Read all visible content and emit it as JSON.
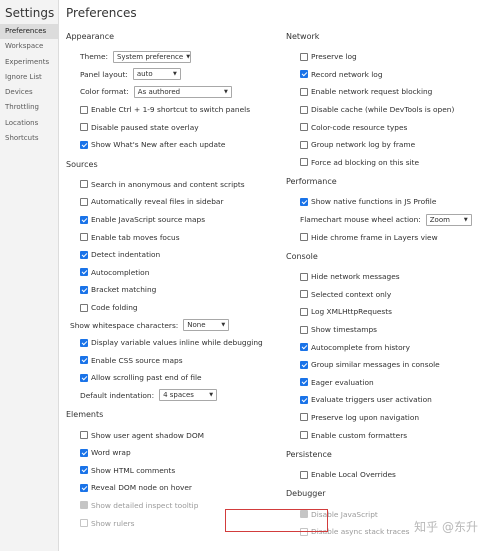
{
  "sidebar": {
    "title": "Settings",
    "items": [
      {
        "label": "Preferences",
        "active": true
      },
      {
        "label": "Workspace"
      },
      {
        "label": "Experiments"
      },
      {
        "label": "Ignore List"
      },
      {
        "label": "Devices"
      },
      {
        "label": "Throttling"
      },
      {
        "label": "Locations"
      },
      {
        "label": "Shortcuts"
      }
    ]
  },
  "main": {
    "title": "Preferences",
    "appearance": {
      "title": "Appearance",
      "theme_label": "Theme:",
      "theme_value": "System preference",
      "panel_layout_label": "Panel layout:",
      "panel_layout_value": "auto",
      "color_format_label": "Color format:",
      "color_format_value": "As authored",
      "enable_ctrl": "Enable Ctrl + 1-9 shortcut to switch panels",
      "disable_paused": "Disable paused state overlay",
      "show_whats_new": "Show What's New after each update"
    },
    "sources": {
      "title": "Sources",
      "search_anon": "Search in anonymous and content scripts",
      "auto_reveal": "Automatically reveal files in sidebar",
      "js_source_maps": "Enable JavaScript source maps",
      "tab_moves_focus": "Enable tab moves focus",
      "detect_indentation": "Detect indentation",
      "autocompletion": "Autocompletion",
      "bracket_matching": "Bracket matching",
      "code_folding": "Code folding",
      "whitespace_label": "Show whitespace characters:",
      "whitespace_value": "None",
      "display_vars_inline": "Display variable values inline while debugging",
      "css_source_maps": "Enable CSS source maps",
      "scroll_past_end": "Allow scrolling past end of file",
      "default_indent_label": "Default indentation:",
      "default_indent_value": "4 spaces"
    },
    "elements": {
      "title": "Elements",
      "user_agent_shadow": "Show user agent shadow DOM",
      "word_wrap": "Word wrap",
      "html_comments": "Show HTML comments",
      "reveal_dom": "Reveal DOM node on hover",
      "inspect_tooltip": "Show detailed inspect tooltip",
      "rulers": "Show rulers"
    },
    "network": {
      "title": "Network",
      "preserve_log": "Preserve log",
      "record_log": "Record network log",
      "request_blocking": "Enable network request blocking",
      "disable_cache": "Disable cache (while DevTools is open)",
      "color_code": "Color-code resource types",
      "group_by_frame": "Group network log by frame",
      "force_ad_block": "Force ad blocking on this site"
    },
    "performance": {
      "title": "Performance",
      "native_functions": "Show native functions in JS Profile",
      "flamechart_label": "Flamechart mouse wheel action:",
      "flamechart_value": "Zoom",
      "hide_chrome_frame": "Hide chrome frame in Layers view"
    },
    "console": {
      "title": "Console",
      "hide_network": "Hide network messages",
      "selected_context": "Selected context only",
      "log_xhr": "Log XMLHttpRequests",
      "timestamps": "Show timestamps",
      "autocomplete_history": "Autocomplete from history",
      "group_similar": "Group similar messages in console",
      "eager_eval": "Eager evaluation",
      "eval_triggers": "Evaluate triggers user activation",
      "preserve_nav": "Preserve log upon navigation",
      "custom_formatters": "Enable custom formatters"
    },
    "persistence": {
      "title": "Persistence",
      "local_overrides": "Enable Local Overrides"
    },
    "debugger": {
      "title": "Debugger",
      "disable_js": "Disable JavaScript",
      "async_stack": "Disable async stack traces"
    }
  },
  "watermark": "知乎 @东升",
  "colors": {
    "accent": "#1a73e8",
    "highlight_box": "#d23c3c"
  }
}
